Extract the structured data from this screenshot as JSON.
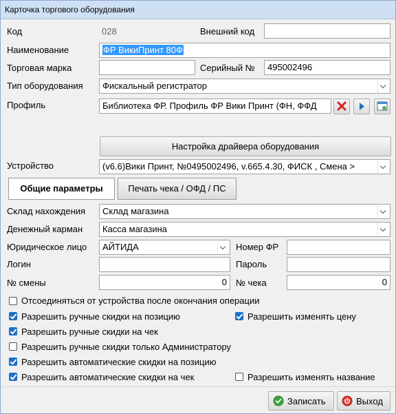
{
  "window": {
    "title": "Карточка торгового оборудования"
  },
  "fields": {
    "code_label": "Код",
    "code_value": "028",
    "external_code_label": "Внешний код",
    "external_code_value": "",
    "name_label": "Наименование",
    "name_value": "ФР ВикиПринт 80Ф",
    "brand_label": "Торговая марка",
    "brand_value": "",
    "serial_label": "Серийный №",
    "serial_value": "495002496",
    "type_label": "Тип оборудования",
    "type_value": "Фискальный регистратор",
    "profile_label": "Профиль",
    "profile_value": "Библиотека ФР. Профиль ФР Вики Принт (ФН, ФФД"
  },
  "driver_button_label": "Настройка драйвера оборудования",
  "device": {
    "label": "Устройство",
    "value": "(v6.6)Вики Принт, №0495002496, v.665.4.30, ФИСК , Смена >"
  },
  "tabs": [
    {
      "label": "Общие параметры",
      "active": true
    },
    {
      "label": "Печать чека / ОФД / ПС",
      "active": false
    }
  ],
  "params": {
    "warehouse_label": "Склад нахождения",
    "warehouse_value": "Склад магазина",
    "cash_label": "Денежный карман",
    "cash_value": "Касса магазина",
    "legal_label": "Юридическое лицо",
    "legal_value": "АЙТИДА",
    "fr_number_label": "Номер ФР",
    "fr_number_value": "",
    "login_label": "Логин",
    "login_value": "",
    "password_label": "Пароль",
    "password_value": "",
    "shift_label": "№ смены",
    "shift_value": "0",
    "receipt_label": "№ чека",
    "receipt_value": "0"
  },
  "checkboxes": [
    {
      "label": "Отсоединяться от устройства после окончания операции",
      "checked": false
    },
    {
      "label": "Разрешить ручные скидки на позицию",
      "checked": true
    },
    {
      "label": "Разрешить изменять цену",
      "checked": true
    },
    {
      "label": "Разрешить ручные скидки на чек",
      "checked": true
    },
    {
      "label": "Разрешить ручные скидки только Администратору",
      "checked": false
    },
    {
      "label": "Разрешить автоматические скидки на позицию",
      "checked": true
    },
    {
      "label": "Разрешить автоматические скидки на чек",
      "checked": true
    },
    {
      "label": "Разрешить изменять название",
      "checked": false
    }
  ],
  "footer": {
    "save_label": "Записать",
    "exit_label": "Выход"
  },
  "colors": {
    "accent": "#1f6fc5",
    "selection": "#3399ff",
    "save_icon": "#3aa53a",
    "exit_icon": "#d9342b"
  },
  "icons": {
    "clear": "red-x-icon",
    "open": "blue-play-icon",
    "settings": "window-settings-icon"
  }
}
